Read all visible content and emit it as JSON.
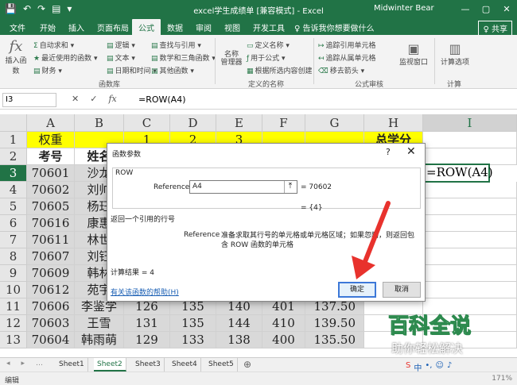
{
  "window": {
    "title": "excel学生成绩单 [兼容模式] - Excel",
    "user": "Midwinter Bear",
    "controls": [
      "—",
      "▢",
      "✕"
    ]
  },
  "quick_access": [
    "💾",
    "↶",
    "↷",
    "▤",
    "▾"
  ],
  "tabs": [
    {
      "label": "文件"
    },
    {
      "label": "开始"
    },
    {
      "label": "插入"
    },
    {
      "label": "页面布局"
    },
    {
      "label": "公式",
      "active": true
    },
    {
      "label": "数据"
    },
    {
      "label": "审阅"
    },
    {
      "label": "视图"
    },
    {
      "label": "开发工具"
    }
  ],
  "tell_me": "♀ 告诉我你想要做什么",
  "share": "♀ 共享",
  "ribbon": {
    "insert_function": "插入函数",
    "autosum": "自动求和",
    "recent": "最近使用的函数",
    "financial": "财务",
    "logical": "逻辑",
    "text": "文本",
    "datetime": "日期和时间",
    "lookup": "查找与引用",
    "math": "数学和三角函数",
    "other": "其他函数",
    "library_label": "函数库",
    "name_manager": "名称\n管理器",
    "define_name": "定义名称",
    "use_in_formula": "用于公式",
    "create_from_sel": "根据所选内容创建",
    "names_label": "定义的名称",
    "trace_precedents": "追踪引用单元格",
    "trace_dependents": "追踪从属单元格",
    "remove_arrows": "移去箭头",
    "audit_label": "公式审核",
    "watch_window": "监视窗口",
    "calc_options": "计算选项",
    "calc_label": "计算"
  },
  "formula_bar": {
    "name_box": "I3",
    "formula": "=ROW(A4)"
  },
  "columns": [
    "A",
    "B",
    "C",
    "D",
    "E",
    "F",
    "G",
    "H",
    "I"
  ],
  "rows": [
    {
      "num": "1",
      "cells": [
        "权重",
        "",
        "1",
        "2",
        "3",
        "",
        "",
        "总学分",
        ""
      ]
    },
    {
      "num": "2",
      "cells": [
        "考号",
        "姓名",
        "",
        "",
        "",
        "",
        "",
        "",
        ""
      ]
    },
    {
      "num": "3",
      "cells": [
        "70601",
        "沙龙",
        "",
        "",
        "",
        "",
        "",
        "",
        "=ROW(A4)"
      ]
    },
    {
      "num": "4",
      "cells": [
        "70602",
        "刘帅",
        "",
        "",
        "",
        "",
        "",
        "",
        ""
      ]
    },
    {
      "num": "5",
      "cells": [
        "70605",
        "杨珏",
        "",
        "",
        "",
        "",
        "",
        "",
        ""
      ]
    },
    {
      "num": "6",
      "cells": [
        "70616",
        "康惠",
        "",
        "",
        "",
        "",
        "",
        "",
        ""
      ]
    },
    {
      "num": "7",
      "cells": [
        "70611",
        "林世",
        "",
        "",
        "",
        "",
        "",
        "",
        ""
      ]
    },
    {
      "num": "8",
      "cells": [
        "70607",
        "刘钰",
        "",
        "",
        "",
        "",
        "",
        "",
        ""
      ]
    },
    {
      "num": "9",
      "cells": [
        "70609",
        "韩林",
        "",
        "",
        "",
        "",
        "",
        "",
        ""
      ]
    },
    {
      "num": "10",
      "cells": [
        "70612",
        "苑宇",
        "",
        "",
        "",
        "",
        "",
        "",
        ""
      ]
    },
    {
      "num": "11",
      "cells": [
        "70606",
        "李鉴学",
        "126",
        "135",
        "140",
        "401",
        "137.50",
        "",
        ""
      ]
    },
    {
      "num": "12",
      "cells": [
        "70603",
        "王雪",
        "131",
        "135",
        "144",
        "410",
        "139.50",
        "",
        ""
      ]
    },
    {
      "num": "13",
      "cells": [
        "70604",
        "韩雨萌",
        "129",
        "133",
        "138",
        "400",
        "135.50",
        "",
        ""
      ]
    }
  ],
  "dialog": {
    "title": "函数参数",
    "help_icon": "?",
    "close_icon": "✕",
    "function_name": "ROW",
    "ref_label": "Reference",
    "ref_value": "A4",
    "ref_result": "=  70602",
    "result_braces": "=  {4}",
    "description": "返回一个引用的行号",
    "param_label": "Reference",
    "param_desc": "准备求取其行号的单元格或单元格区域；如果忽略，则返回包含 ROW 函数的单元格",
    "calc_result": "计算结果 =   4",
    "help_link": "有关该函数的帮助(H)",
    "ok": "确定",
    "cancel": "取消"
  },
  "sheets": [
    "Sheet1",
    "Sheet2",
    "Sheet3",
    "Sheet4",
    "Sheet5"
  ],
  "active_sheet": "Sheet2",
  "status": {
    "mode": "编辑",
    "zoom": "171%"
  },
  "watermark": {
    "main": "百科全说",
    "sub": "助你轻松解决"
  },
  "colors": {
    "excel_green": "#217346",
    "yellow": "#ffff00",
    "arrow": "#e8322d"
  }
}
